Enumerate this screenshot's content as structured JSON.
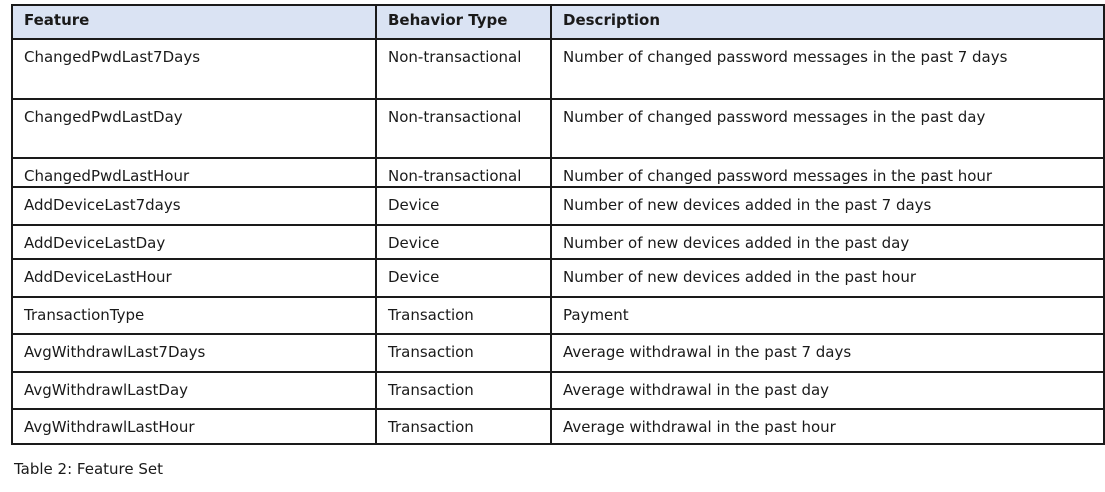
{
  "table": {
    "headers": [
      "Feature",
      "Behavior Type",
      "Description"
    ],
    "rows": [
      [
        "ChangedPwdLast7Days",
        "Non-transactional",
        "Number of changed password messages in the past 7 days"
      ],
      [
        "ChangedPwdLastDay",
        "Non-transactional",
        "Number of changed password messages in the past day"
      ],
      [
        "ChangedPwdLastHour",
        "Non-transactional",
        "Number of changed password messages in the past hour"
      ],
      [
        "AddDeviceLast7days",
        "Device",
        "Number of new devices added in the past 7 days"
      ],
      [
        "AddDeviceLastDay",
        "Device",
        "Number of new devices added in the past day"
      ],
      [
        "AddDeviceLastHour",
        "Device",
        "Number of new devices added in the past hour"
      ],
      [
        "TransactionType",
        "Transaction",
        "Payment"
      ],
      [
        "AvgWithdrawlLast7Days",
        "Transaction",
        "Average withdrawal in the past 7 days"
      ],
      [
        "AvgWithdrawlLastDay",
        "Transaction",
        "Average withdrawal in the past day"
      ],
      [
        "AvgWithdrawlLastHour",
        "Transaction",
        "Average withdrawal in the past hour"
      ]
    ]
  },
  "caption": "Table 2: Feature Set",
  "colors": {
    "header_background": "#dae3f3",
    "border": "#1a1a1a"
  }
}
